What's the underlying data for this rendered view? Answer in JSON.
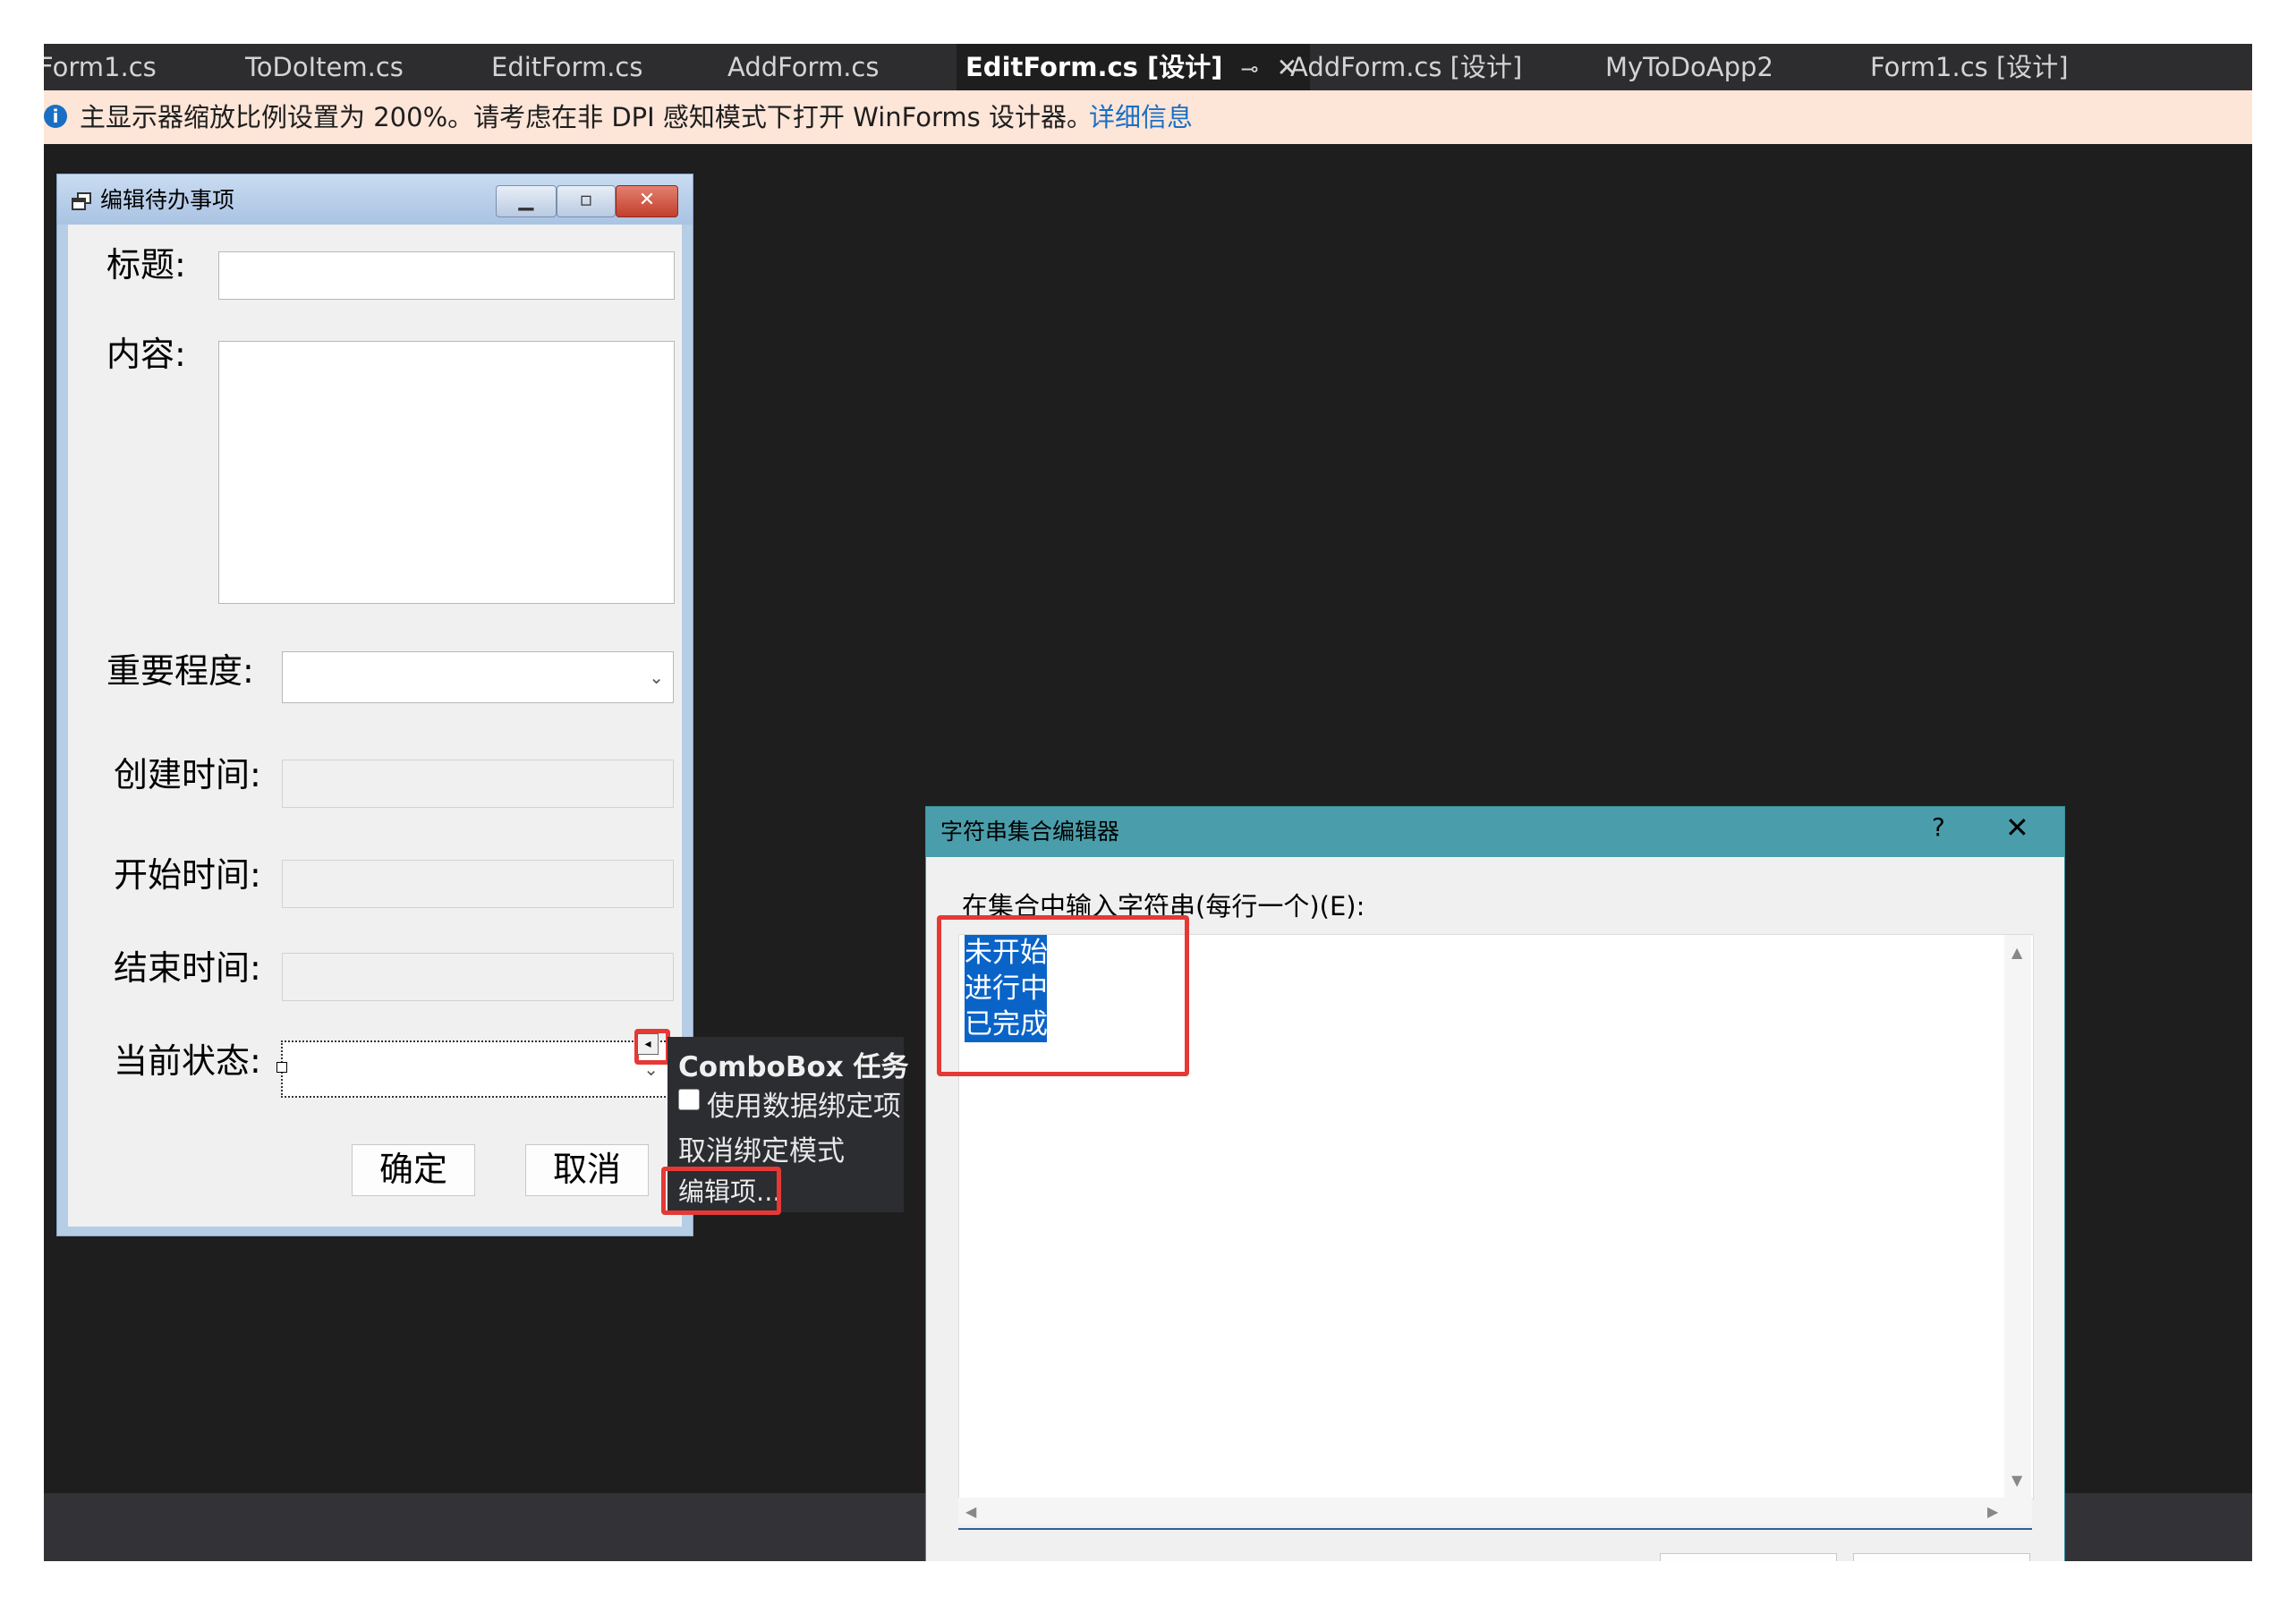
{
  "tabs": [
    {
      "label": "Form1.cs",
      "active": false
    },
    {
      "label": "ToDoItem.cs",
      "active": false
    },
    {
      "label": "EditForm.cs",
      "active": false
    },
    {
      "label": "AddForm.cs",
      "active": false
    },
    {
      "label": "EditForm.cs [设计]",
      "active": true
    },
    {
      "label": "AddForm.cs [设计]",
      "active": false
    },
    {
      "label": "MyToDoApp2",
      "active": false
    },
    {
      "label": "Form1.cs [设计]",
      "active": false
    }
  ],
  "active_tab_icons": {
    "pin": "pin-icon",
    "close": "close-icon"
  },
  "info_bar": {
    "icon": "info-icon",
    "message": "主显示器缩放比例设置为 200%。请考虑在非 DPI 感知模式下打开 WinForms 设计器。",
    "link": "详细信息"
  },
  "form": {
    "title": "编辑待办事项",
    "labels": {
      "title": "标题:",
      "content": "内容:",
      "importance": "重要程度:",
      "created": "创建时间:",
      "start": "开始时间:",
      "end": "结束时间:",
      "status": "当前状态:"
    },
    "buttons": {
      "ok": "确定",
      "cancel": "取消"
    }
  },
  "combobox_tasks": {
    "title": "ComboBox 任务",
    "use_data_bound": "使用数据绑定项",
    "unbind_mode": "取消绑定模式",
    "edit_items": "编辑项..."
  },
  "string_editor": {
    "title": "字符串集合编辑器",
    "help": "?",
    "prompt": "在集合中输入字符串(每行一个)(E):",
    "items": [
      "未开始",
      "进行中",
      "已完成"
    ]
  },
  "colors": {
    "ide_background": "#1e1e1e",
    "info_bar": "#fde5d8",
    "link": "#1a6fc4",
    "selection": "#0a64c8",
    "highlight_box": "#e53935",
    "editor_titlebar": "#4a9eab"
  }
}
